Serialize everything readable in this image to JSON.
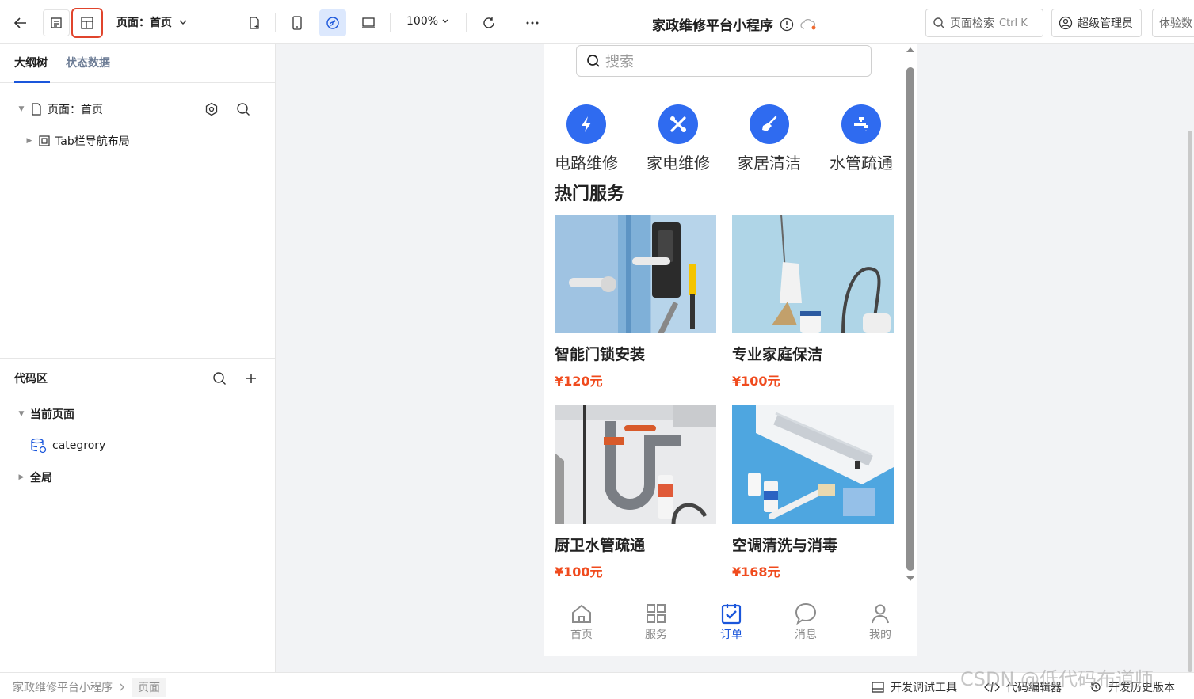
{
  "topbar": {
    "page_selector": "页面：首页",
    "zoom": "100%",
    "app_title": "家政维修平台小程序",
    "search_label": "页面检索",
    "search_shortcut": "Ctrl K",
    "user_label": "超级管理员",
    "trial_label": "体验数"
  },
  "left_panel": {
    "tabs": [
      "大纲树",
      "状态数据"
    ],
    "outline": {
      "page_node": "页面：首页",
      "child_node": "Tab栏导航布局"
    },
    "code_area": {
      "title": "代码区",
      "current_page": "当前页面",
      "item": "categrory",
      "global": "全局"
    }
  },
  "phone": {
    "search_placeholder": "搜索",
    "categories": [
      {
        "label": "电路维修",
        "icon": "lightning-icon"
      },
      {
        "label": "家电维修",
        "icon": "tools-icon"
      },
      {
        "label": "家居清洁",
        "icon": "broom-icon"
      },
      {
        "label": "水管疏通",
        "icon": "faucet-icon"
      }
    ],
    "hot_title": "热门服务",
    "services": [
      {
        "name": "智能门锁安装",
        "price": "¥120元"
      },
      {
        "name": "专业家庭保洁",
        "price": "¥100元"
      },
      {
        "name": "厨卫水管疏通",
        "price": "¥100元"
      },
      {
        "name": "空调清洗与消毒",
        "price": "¥168元"
      }
    ],
    "tabbar": [
      {
        "label": "首页",
        "icon": "home-icon"
      },
      {
        "label": "服务",
        "icon": "grid-icon"
      },
      {
        "label": "订单",
        "icon": "order-check-icon"
      },
      {
        "label": "消息",
        "icon": "message-icon"
      },
      {
        "label": "我的",
        "icon": "user-icon"
      }
    ],
    "active_tab": "订单"
  },
  "statusbar": {
    "breadcrumb": [
      "家政维修平台小程序",
      "页面"
    ],
    "debug_tools": "开发调试工具",
    "code_editor": "代码编辑器",
    "history": "开发历史版本"
  },
  "watermark": "CSDN @低代码布道师",
  "colors": {
    "accent": "#1a56db",
    "price": "#f04b1e",
    "category_circle": "#2f6bf0"
  }
}
